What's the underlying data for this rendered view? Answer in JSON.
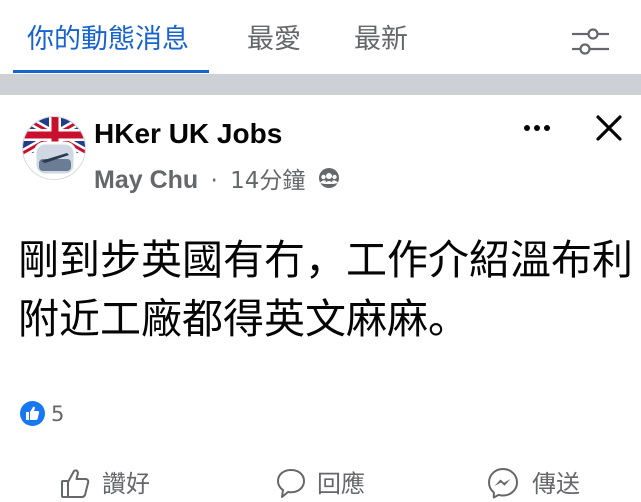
{
  "tabs": [
    {
      "label": "你的動態消息",
      "active": true
    },
    {
      "label": "最愛",
      "active": false
    },
    {
      "label": "最新",
      "active": false
    }
  ],
  "icons": {
    "filter": "sliders-icon",
    "more": "more-horizontal-icon",
    "close": "close-icon",
    "audience": "group-audience-icon",
    "like_badge": "thumbs-up-icon",
    "like_action": "thumbs-up-outline-icon",
    "comment_action": "comment-bubble-icon",
    "share_action": "messenger-icon"
  },
  "colors": {
    "accent": "#1763cf",
    "like_blue": "#1877f2",
    "secondary_text": "#65676b",
    "separator": "#cdd0d4"
  },
  "post": {
    "group_name": "HKer UK Jobs",
    "author": "May Chu",
    "separator": "·",
    "time": "14分鐘",
    "text": "剛到步英國有冇，工作介紹溫布利附近工廠都得英文麻麻。",
    "likes": "5"
  },
  "actions": {
    "like": "讚好",
    "comment": "回應",
    "share": "傳送"
  }
}
